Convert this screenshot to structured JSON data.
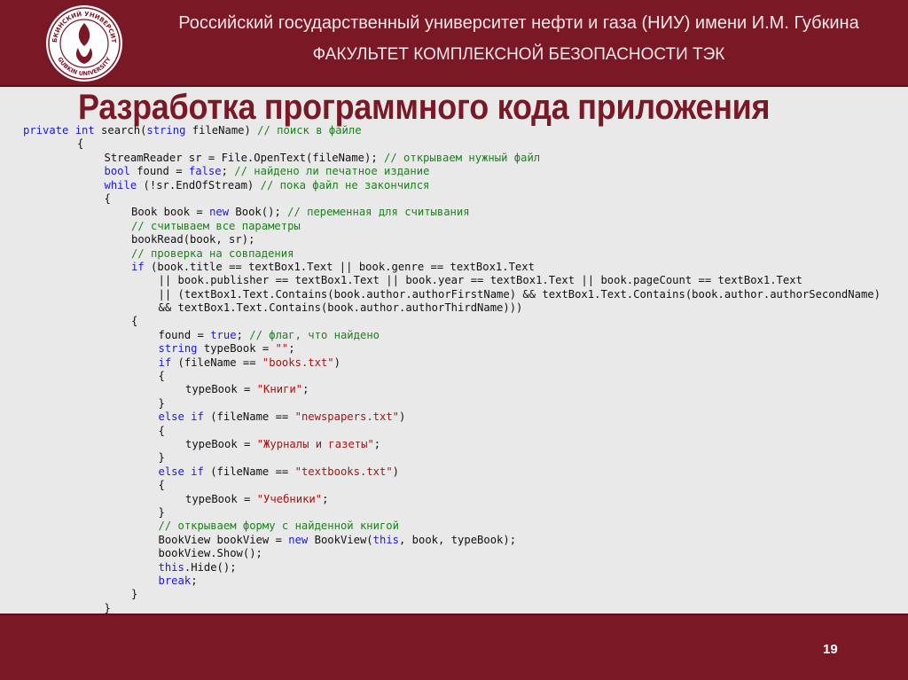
{
  "header": {
    "university": "Российский государственный университет нефти и газа (НИУ) имени И.М. Губкина",
    "faculty": "ФАКУЛЬТЕТ КОМПЛЕКСНОЙ БЕЗОПАСНОСТИ ТЭК",
    "logo_text_top": "ГУБКИНСКИЙ УНИВЕРСИТЕТ",
    "logo_text_bottom": "GUBKIN UNIVERSITY"
  },
  "slide": {
    "title": "Разработка программного кода приложения",
    "page_number": "19"
  },
  "code_lines": [
    {
      "indent": 0,
      "parts": [
        {
          "k": "kw",
          "t": "private int"
        },
        {
          "k": "",
          "t": " search("
        },
        {
          "k": "kw",
          "t": "string"
        },
        {
          "k": "",
          "t": " fileName) "
        },
        {
          "k": "cm",
          "t": "// поиск в файле"
        }
      ]
    },
    {
      "indent": 2,
      "parts": [
        {
          "k": "",
          "t": "{"
        }
      ]
    },
    {
      "indent": 3,
      "parts": [
        {
          "k": "",
          "t": "StreamReader sr = File.OpenText(fileName); "
        },
        {
          "k": "cm",
          "t": "// открываем нужный файл"
        }
      ]
    },
    {
      "indent": 3,
      "parts": [
        {
          "k": "kw",
          "t": "bool"
        },
        {
          "k": "",
          "t": " found = "
        },
        {
          "k": "kw",
          "t": "false"
        },
        {
          "k": "",
          "t": "; "
        },
        {
          "k": "cm",
          "t": "// найдено ли печатное издание"
        }
      ]
    },
    {
      "indent": 3,
      "parts": [
        {
          "k": "kw",
          "t": "while"
        },
        {
          "k": "",
          "t": " (!sr.EndOfStream) "
        },
        {
          "k": "cm",
          "t": "// пока файл не закончился"
        }
      ]
    },
    {
      "indent": 3,
      "parts": [
        {
          "k": "",
          "t": "{"
        }
      ]
    },
    {
      "indent": 4,
      "parts": [
        {
          "k": "",
          "t": "Book book = "
        },
        {
          "k": "kw",
          "t": "new"
        },
        {
          "k": "",
          "t": " Book(); "
        },
        {
          "k": "cm",
          "t": "// переменная для считывания"
        }
      ]
    },
    {
      "indent": 4,
      "parts": [
        {
          "k": "cm",
          "t": "// считываем все параметры"
        }
      ]
    },
    {
      "indent": 4,
      "parts": [
        {
          "k": "",
          "t": "bookRead(book, sr);"
        }
      ]
    },
    {
      "indent": 4,
      "parts": [
        {
          "k": "cm",
          "t": "// проверка на совпадения"
        }
      ]
    },
    {
      "indent": 4,
      "parts": [
        {
          "k": "kw",
          "t": "if"
        },
        {
          "k": "",
          "t": " (book.title == textBox1.Text || book.genre == textBox1.Text"
        }
      ]
    },
    {
      "indent": 5,
      "parts": [
        {
          "k": "",
          "t": "|| book.publisher == textBox1.Text || book.year == textBox1.Text || book.pageCount == textBox1.Text"
        }
      ]
    },
    {
      "indent": 5,
      "parts": [
        {
          "k": "",
          "t": "|| (textBox1.Text.Contains(book.author.authorFirstName) && textBox1.Text.Contains(book.author.authorSecondName)"
        }
      ]
    },
    {
      "indent": 5,
      "parts": [
        {
          "k": "",
          "t": "&& textBox1.Text.Contains(book.author.authorThirdName)))"
        }
      ]
    },
    {
      "indent": 4,
      "parts": [
        {
          "k": "",
          "t": "{"
        }
      ]
    },
    {
      "indent": 5,
      "parts": [
        {
          "k": "",
          "t": "found = "
        },
        {
          "k": "kw",
          "t": "true"
        },
        {
          "k": "",
          "t": "; "
        },
        {
          "k": "cm",
          "t": "// флаг, что найдено"
        }
      ]
    },
    {
      "indent": 5,
      "parts": [
        {
          "k": "kw",
          "t": "string"
        },
        {
          "k": "",
          "t": " typeBook = "
        },
        {
          "k": "st",
          "t": "\"\""
        },
        {
          "k": "",
          "t": ";"
        }
      ]
    },
    {
      "indent": 5,
      "parts": [
        {
          "k": "kw",
          "t": "if"
        },
        {
          "k": "",
          "t": " (fileName == "
        },
        {
          "k": "st",
          "t": "\"books.txt\""
        },
        {
          "k": "",
          "t": ")"
        }
      ]
    },
    {
      "indent": 5,
      "parts": [
        {
          "k": "",
          "t": "{"
        }
      ]
    },
    {
      "indent": 6,
      "parts": [
        {
          "k": "",
          "t": "typeBook = "
        },
        {
          "k": "st",
          "t": "\"Книги\""
        },
        {
          "k": "",
          "t": ";"
        }
      ]
    },
    {
      "indent": 5,
      "parts": [
        {
          "k": "",
          "t": "}"
        }
      ]
    },
    {
      "indent": 5,
      "parts": [
        {
          "k": "kw",
          "t": "else if"
        },
        {
          "k": "",
          "t": " (fileName == "
        },
        {
          "k": "st",
          "t": "\"newspapers.txt\""
        },
        {
          "k": "",
          "t": ")"
        }
      ]
    },
    {
      "indent": 5,
      "parts": [
        {
          "k": "",
          "t": "{"
        }
      ]
    },
    {
      "indent": 6,
      "parts": [
        {
          "k": "",
          "t": "typeBook = "
        },
        {
          "k": "st",
          "t": "\"Журналы и газеты\""
        },
        {
          "k": "",
          "t": ";"
        }
      ]
    },
    {
      "indent": 5,
      "parts": [
        {
          "k": "",
          "t": "}"
        }
      ]
    },
    {
      "indent": 5,
      "parts": [
        {
          "k": "kw",
          "t": "else if"
        },
        {
          "k": "",
          "t": " (fileName == "
        },
        {
          "k": "st",
          "t": "\"textbooks.txt\""
        },
        {
          "k": "",
          "t": ")"
        }
      ]
    },
    {
      "indent": 5,
      "parts": [
        {
          "k": "",
          "t": "{"
        }
      ]
    },
    {
      "indent": 6,
      "parts": [
        {
          "k": "",
          "t": "typeBook = "
        },
        {
          "k": "st",
          "t": "\"Учебники\""
        },
        {
          "k": "",
          "t": ";"
        }
      ]
    },
    {
      "indent": 5,
      "parts": [
        {
          "k": "",
          "t": "}"
        }
      ]
    },
    {
      "indent": 5,
      "parts": [
        {
          "k": "cm",
          "t": "// открываем форму с найденной книгой"
        }
      ]
    },
    {
      "indent": 5,
      "parts": [
        {
          "k": "",
          "t": "BookView bookView = "
        },
        {
          "k": "kw",
          "t": "new"
        },
        {
          "k": "",
          "t": " BookView("
        },
        {
          "k": "kw",
          "t": "this"
        },
        {
          "k": "",
          "t": ", book, typeBook);"
        }
      ]
    },
    {
      "indent": 5,
      "parts": [
        {
          "k": "",
          "t": "bookView.Show();"
        }
      ]
    },
    {
      "indent": 5,
      "parts": [
        {
          "k": "kw",
          "t": "this"
        },
        {
          "k": "",
          "t": ".Hide();"
        }
      ]
    },
    {
      "indent": 5,
      "parts": [
        {
          "k": "kw",
          "t": "break"
        },
        {
          "k": "",
          "t": ";"
        }
      ]
    },
    {
      "indent": 4,
      "parts": [
        {
          "k": "",
          "t": "}"
        }
      ]
    },
    {
      "indent": 3,
      "parts": [
        {
          "k": "",
          "t": "}"
        }
      ]
    }
  ]
}
